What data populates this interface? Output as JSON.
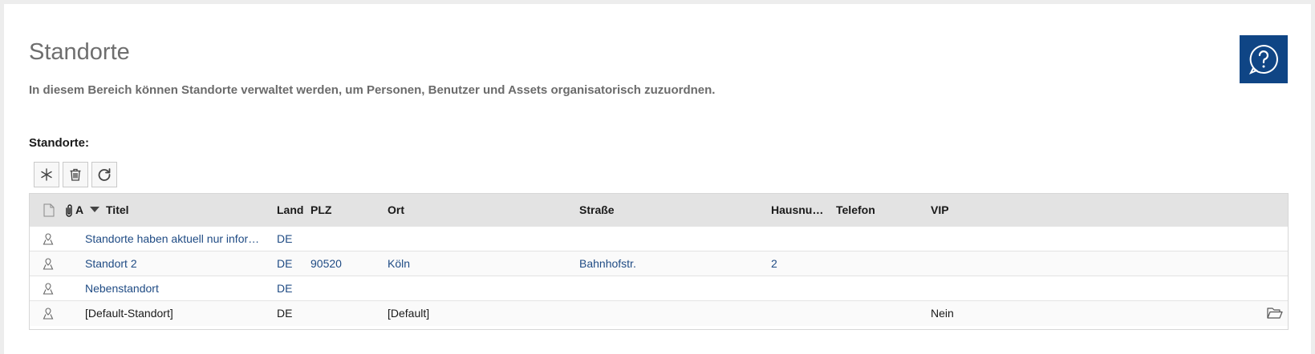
{
  "page": {
    "title": "Standorte",
    "description": "In diesem Bereich können Standorte verwaltet werden, um Personen, Benutzer und Assets organisatorisch zuzuordnen.",
    "help_icon": "help-chat-icon",
    "accent_color": "#0f4585"
  },
  "section": {
    "label": "Standorte:"
  },
  "toolbar": {
    "new_icon": "asterisk-icon",
    "delete_icon": "trash-icon",
    "refresh_icon": "refresh-icon"
  },
  "table": {
    "headers": {
      "attach_abbrev": "A",
      "titel": "Titel",
      "land": "Land",
      "plz": "PLZ",
      "ort": "Ort",
      "strasse": "Straße",
      "hausnummer": "Hausnum…",
      "telefon": "Telefon",
      "vip": "VIP"
    },
    "rows": [
      {
        "titel": "Standorte haben aktuell nur informat…",
        "land": "DE",
        "plz": "",
        "ort": "",
        "strasse": "",
        "hausnummer": "",
        "telefon": "",
        "vip": ""
      },
      {
        "titel": "Standort 2",
        "land": "DE",
        "plz": "90520",
        "ort": "Köln",
        "strasse": "Bahnhofstr.",
        "hausnummer": "2",
        "telefon": "",
        "vip": ""
      },
      {
        "titel": "Nebenstandort",
        "land": "DE",
        "plz": "",
        "ort": "",
        "strasse": "",
        "hausnummer": "",
        "telefon": "",
        "vip": ""
      },
      {
        "titel": "[Default-Standort]",
        "land": "DE",
        "plz": "",
        "ort": "[Default]",
        "strasse": "",
        "hausnummer": "",
        "telefon": "",
        "vip": "Nein"
      }
    ]
  }
}
